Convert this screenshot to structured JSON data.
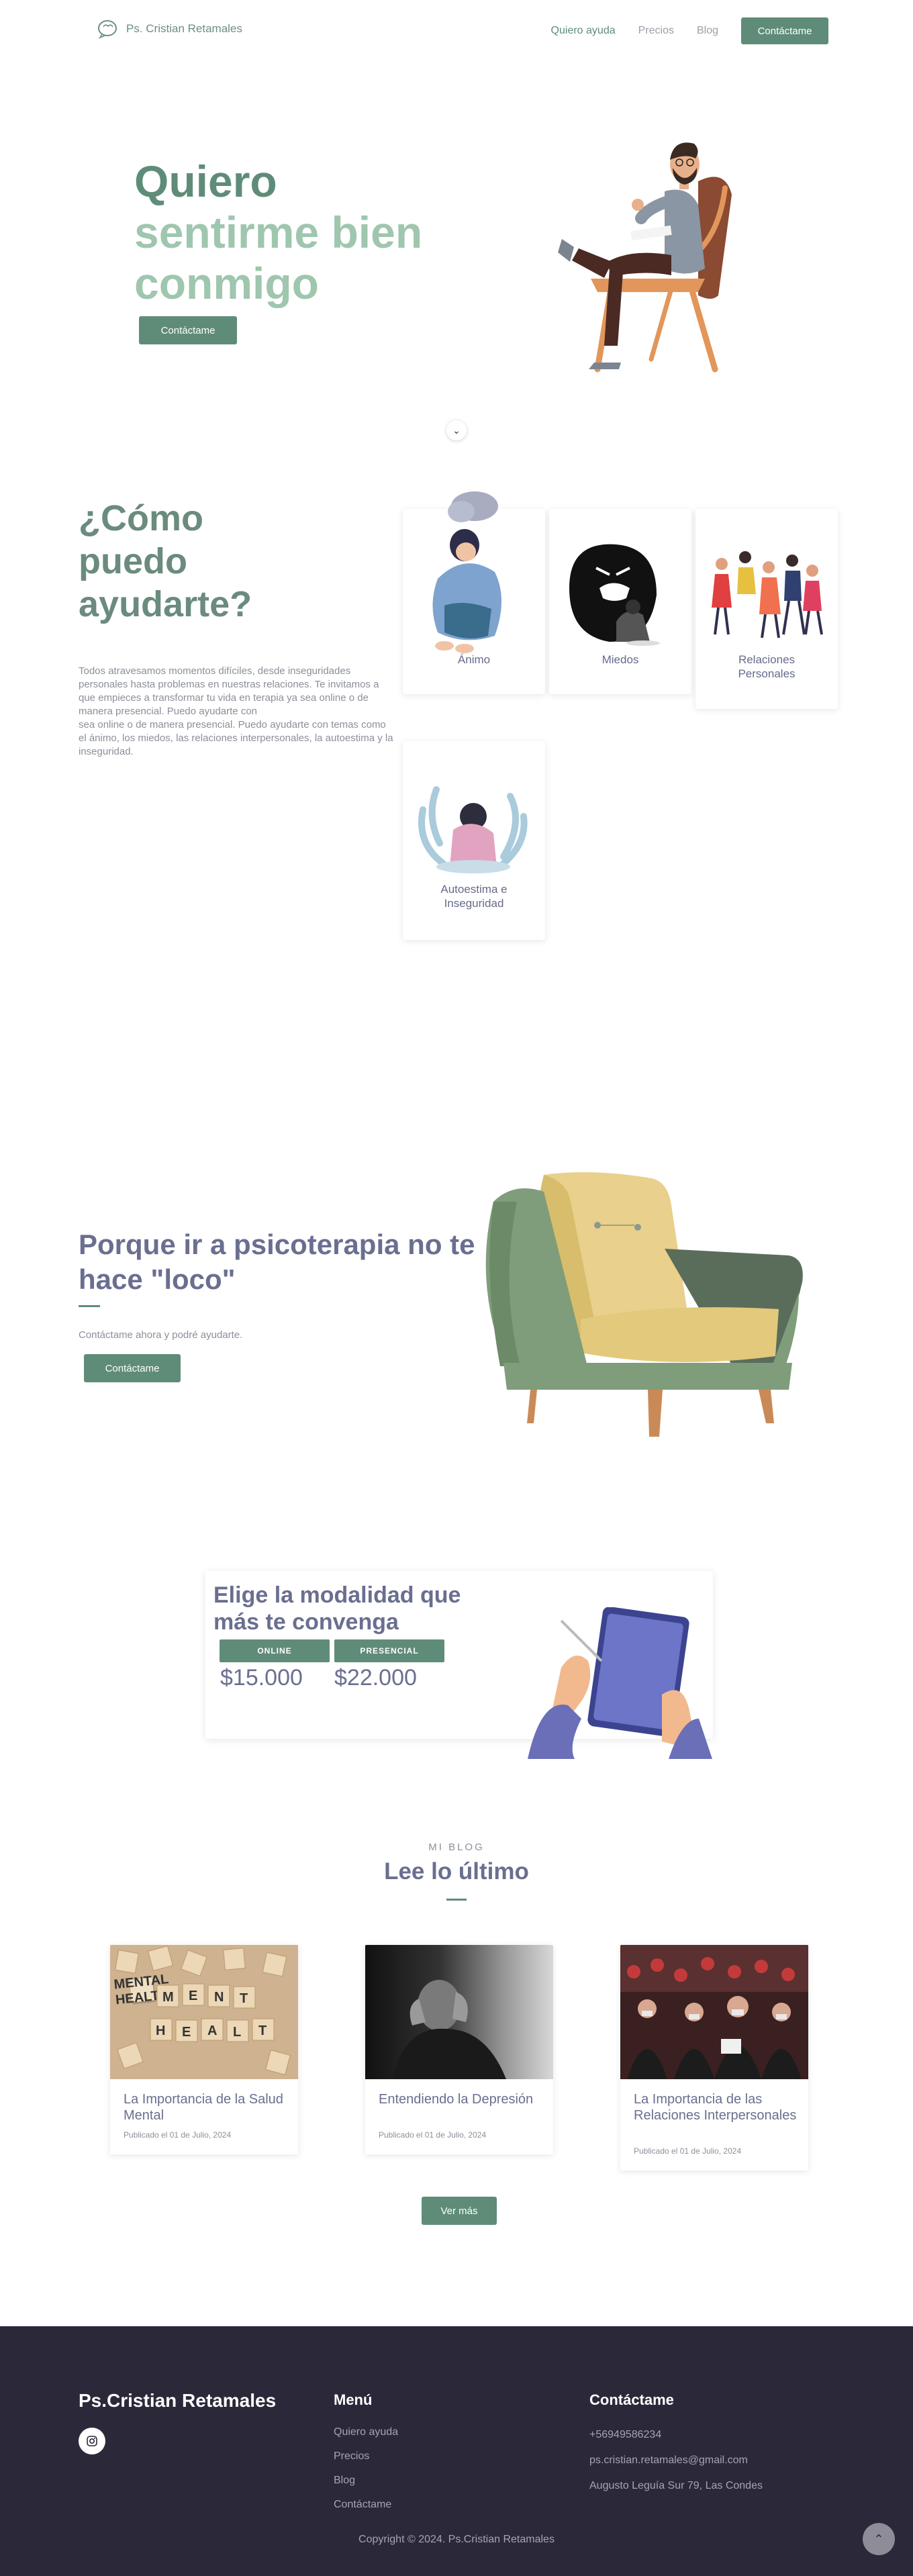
{
  "nav": {
    "brand": "Ps. Cristian Retamales",
    "links": [
      "Quiero ayuda",
      "Precios",
      "Blog"
    ],
    "cta": "Contáctame"
  },
  "hero": {
    "line1": "Quiero",
    "line2": "sentirme bien",
    "line3": "conmigo",
    "cta": "Contáctame"
  },
  "help": {
    "title_l1": "¿Cómo",
    "title_l2": "puedo",
    "title_l3": "ayudarte?",
    "text_1": "Todos atravesamos momentos difíciles, desde inseguridades personales hasta problemas en nuestras relaciones. Te invitamos a que empieces a transformar tu vida en terapia ya sea online o de manera presencial. Puedo ayudarte con",
    "text_2": "sea online o de manera presencial. Puedo ayudarte con temas como el ánimo, los miedos, las relaciones interpersonales, la autoestima y la inseguridad.",
    "cards": [
      {
        "label": "Ánimo"
      },
      {
        "label": "Miedos"
      },
      {
        "label": "Relaciones Personales"
      },
      {
        "label": "Autoestima e Inseguridad"
      }
    ]
  },
  "therapy": {
    "title": "Porque ir a psicoterapia no te hace \"loco\"",
    "subtitle": "Contáctame ahora y podré ayudarte.",
    "cta": "Contáctame"
  },
  "modality": {
    "title": "Elige la modalidad que más te convenga",
    "options": [
      {
        "label": "ONLINE",
        "price": "$15.000"
      },
      {
        "label": "PRESENCIAL",
        "price": "$22.000"
      }
    ]
  },
  "blog": {
    "kicker": "MI BLOG",
    "title": "Lee lo último",
    "posts": [
      {
        "title": "La Importancia de la Salud Mental",
        "date": "Publicado el 01 de Julio, 2024",
        "image_text": "MENTAL HEALTH"
      },
      {
        "title": "Entendiendo la Depresión",
        "date": "Publicado el 01 de Julio, 2024"
      },
      {
        "title": "La Importancia de las Relaciones Interpersonales",
        "date": "Publicado el 01 de Julio, 2024"
      }
    ],
    "more": "Ver más"
  },
  "footer": {
    "brand": "Ps.Cristian Retamales",
    "menu_title": "Menú",
    "menu": [
      "Quiero ayuda",
      "Precios",
      "Blog",
      "Contáctame"
    ],
    "contact_title": "Contáctame",
    "phone": "+56949586234",
    "email": "ps.cristian.retamales@gmail.com",
    "address": "Augusto Leguía Sur 79, Las Condes",
    "copyright": "Copyright © 2024. Ps.Cristian Retamales"
  },
  "colors": {
    "accent": "#5f8c78",
    "accent_light": "#9fc6ae",
    "footer_bg": "#2b2939",
    "heading": "#6a6f90"
  }
}
